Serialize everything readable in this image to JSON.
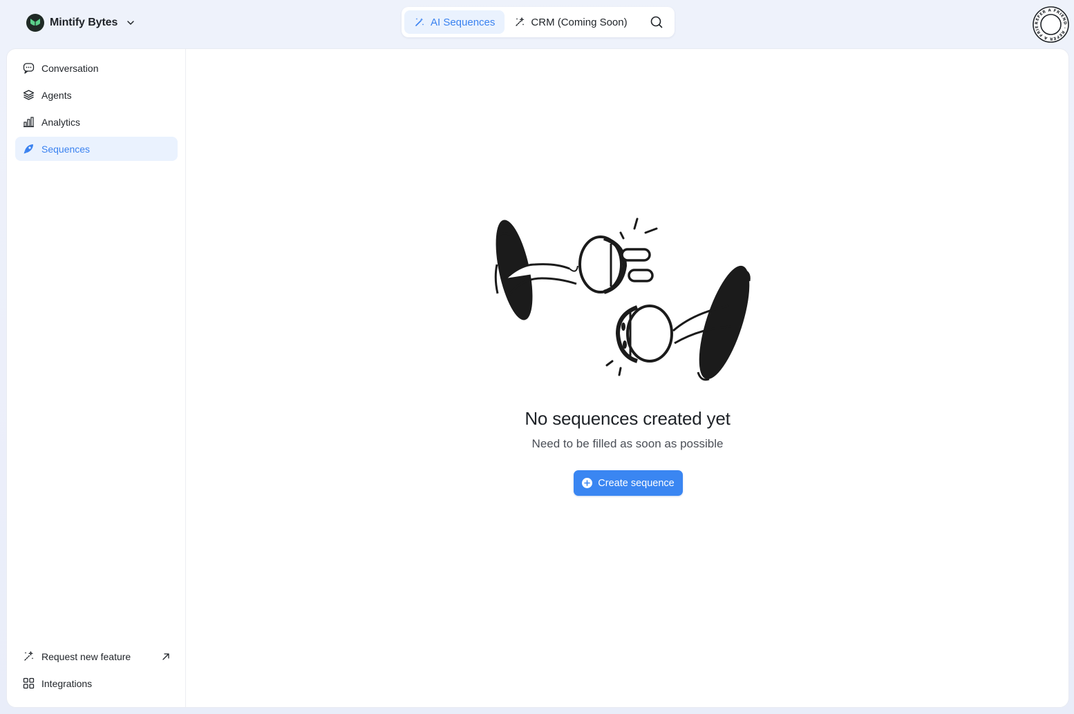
{
  "workspace": {
    "name": "Mintify Bytes"
  },
  "topnav": {
    "tabs": [
      {
        "label": "AI Sequences",
        "active": true,
        "icon": "magic-wand-icon"
      },
      {
        "label": "CRM (Coming Soon)",
        "active": false,
        "icon": "sparkle-wand-icon"
      }
    ],
    "search_icon": "search-icon"
  },
  "badge": {
    "text": "REFER A FRIEND · REFER A FRIEND ·"
  },
  "sidebar": {
    "items": [
      {
        "label": "Conversation",
        "icon": "chat-icon",
        "active": false
      },
      {
        "label": "Agents",
        "icon": "layers-icon",
        "active": false
      },
      {
        "label": "Analytics",
        "icon": "bar-chart-icon",
        "active": false
      },
      {
        "label": "Sequences",
        "icon": "rocket-icon",
        "active": true
      }
    ],
    "bottom": [
      {
        "label": "Request new feature",
        "icon": "magic-wand-icon",
        "external": true
      },
      {
        "label": "Integrations",
        "icon": "grid-icon",
        "external": false
      }
    ]
  },
  "empty_state": {
    "title": "No sequences created yet",
    "subtitle": "Need to be filled as soon as possible",
    "button_label": "Create sequence"
  },
  "colors": {
    "accent": "#3a86f2",
    "active_bg": "#eaf2fe",
    "brand_green": "#5bd08a"
  }
}
